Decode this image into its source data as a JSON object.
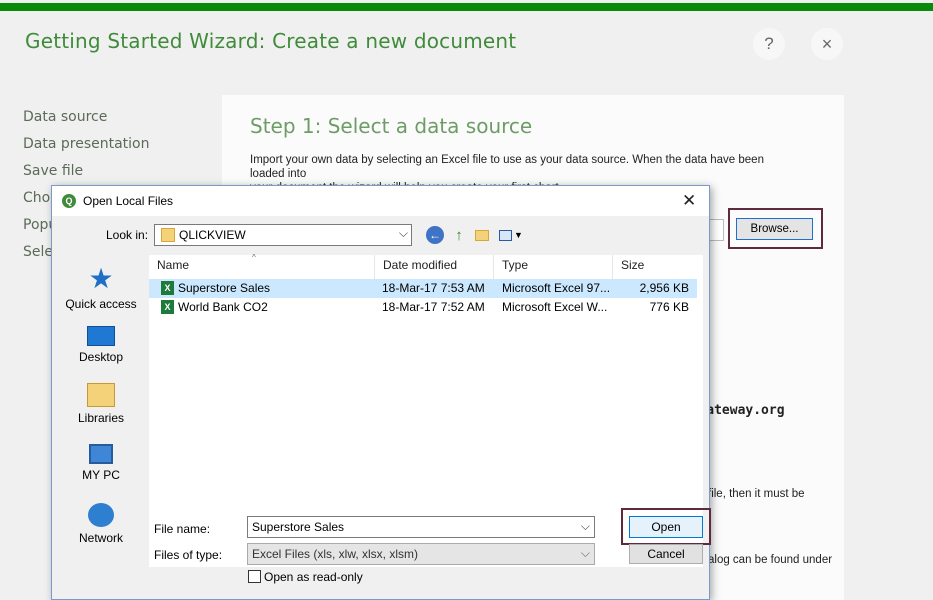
{
  "wizard": {
    "title": "Getting Started Wizard: Create a new document",
    "help_label": "?",
    "close_label": "×",
    "nav": [
      "Data source",
      "Data presentation",
      "Save file",
      "Choo",
      "Popu",
      "Sele"
    ],
    "step_title": "Step 1:  Select a data source",
    "step_desc_line1": "Import your own data by selecting an Excel file to use as your data source. When the data have been loaded into",
    "step_desc_line2": "your document the wizard will help you create your first chart.",
    "browse_label": "Browse...",
    "side_text_1": "file, then it must be",
    "side_text_2": "",
    "side_text_3": "alog can be found under",
    "watermark": "©tutorialgateway.org",
    "accent_color": "#3f8b3a"
  },
  "dialog": {
    "title": "Open Local Files",
    "app_icon_letter": "Q",
    "close_label": "✕",
    "look_in_label": "Look in:",
    "look_in_value": "QLICKVIEW",
    "places": [
      {
        "label": "Quick access",
        "icon": "star-icon"
      },
      {
        "label": "Desktop",
        "icon": "desktop-icon"
      },
      {
        "label": "Libraries",
        "icon": "libraries-icon"
      },
      {
        "label": "MY PC",
        "icon": "computer-icon"
      },
      {
        "label": "Network",
        "icon": "network-icon"
      }
    ],
    "columns": [
      "Name",
      "Date modified",
      "Type",
      "Size"
    ],
    "files": [
      {
        "name": "Superstore Sales",
        "date": "18-Mar-17 7:53 AM",
        "type": "Microsoft Excel 97...",
        "size": "2,956 KB",
        "selected": true
      },
      {
        "name": "World Bank CO2",
        "date": "18-Mar-17 7:52 AM",
        "type": "Microsoft Excel W...",
        "size": "776 KB",
        "selected": false
      }
    ],
    "file_name_label": "File name:",
    "file_name_value": "Superstore Sales",
    "file_type_label": "Files of type:",
    "file_type_value": "Excel Files (xls, xlw, xlsx, xlsm)",
    "read_only_label": "Open as read-only",
    "open_label": "Open",
    "cancel_label": "Cancel"
  }
}
